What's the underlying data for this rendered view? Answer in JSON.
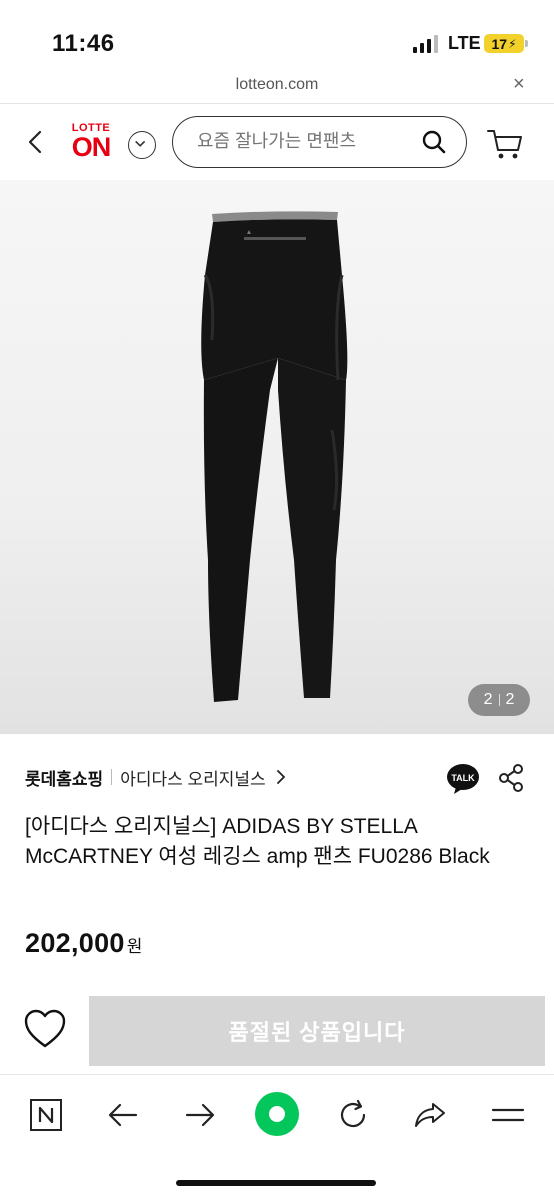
{
  "status_bar": {
    "time": "11:46",
    "network": "LTE",
    "battery": "17"
  },
  "browser": {
    "url": "lotteon.com",
    "close_glyph": "×"
  },
  "header": {
    "logo_top": "LOTTE",
    "logo_main": "ON",
    "search_placeholder": "요즘 잘나가는 면팬츠"
  },
  "gallery": {
    "current": "2",
    "total": "2",
    "background": "#f1f1f1"
  },
  "product": {
    "seller": "롯데홈쇼핑",
    "brand": "아디다스 오리지널스",
    "title": "[아디다스 오리지널스] ADIDAS BY STELLA McCARTNEY 여성 레깅스 amp 팬츠 FU0286 Black",
    "price": "202,000",
    "currency": "원"
  },
  "actions": {
    "soldout_label": "품절된 상품입니다"
  },
  "toolbar": {
    "accent_color": "#03c75a",
    "icons": [
      "naver-icon",
      "back-arrow-icon",
      "forward-arrow-icon",
      "home-dot-icon",
      "refresh-icon",
      "share-arrow-icon",
      "menu-icon"
    ]
  },
  "colors": {
    "brand_red": "#e60012",
    "battery_yellow": "#f2d12b",
    "soldout_gray": "#d6d6d6"
  }
}
